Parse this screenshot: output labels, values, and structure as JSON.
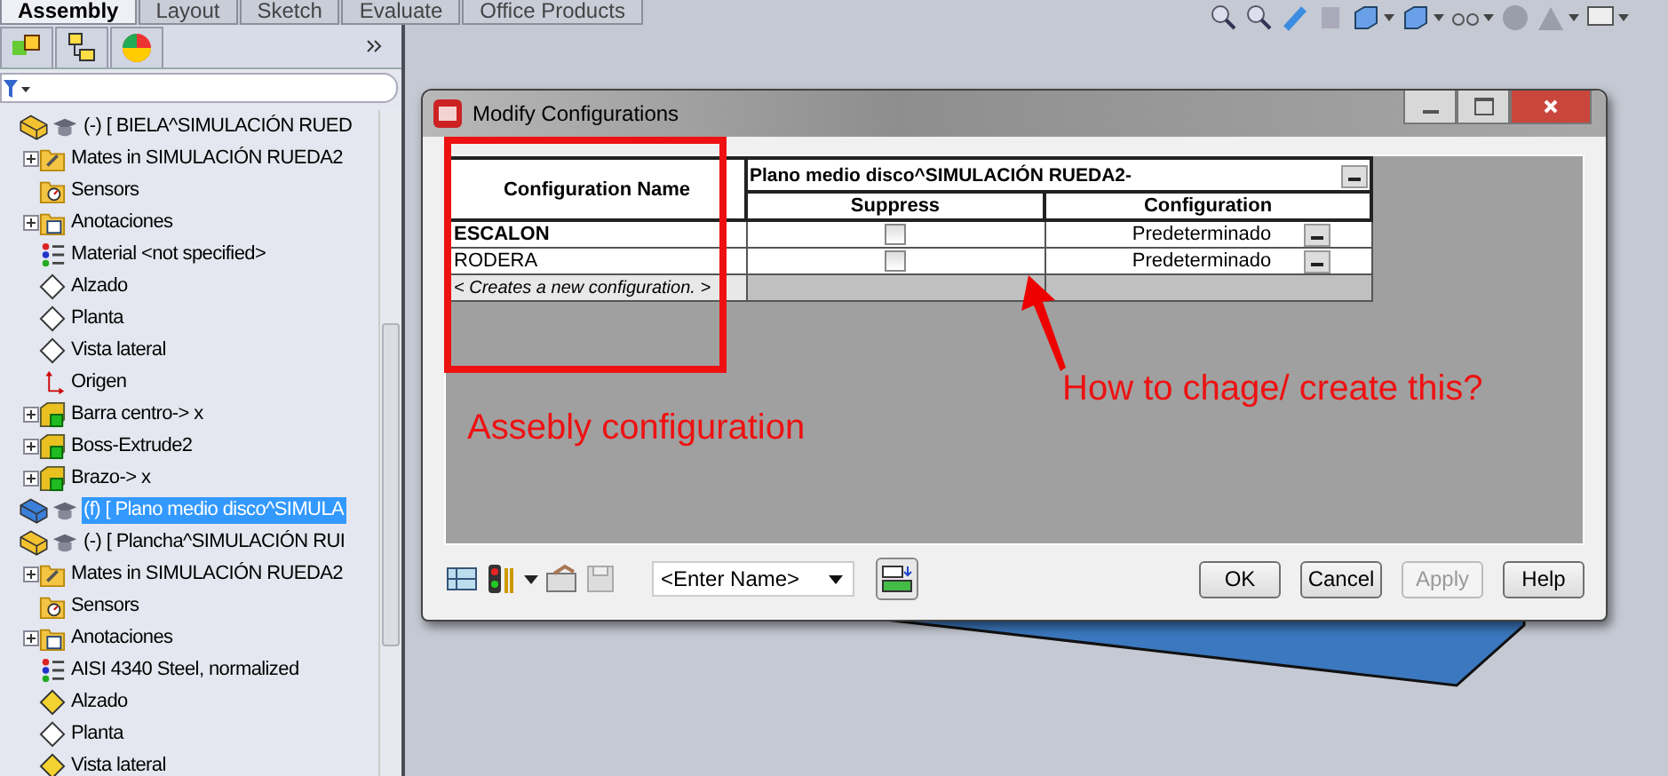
{
  "command_tabs": [
    {
      "label": "Assembly",
      "selected": true
    },
    {
      "label": "Layout",
      "selected": false
    },
    {
      "label": "Sketch",
      "selected": false
    },
    {
      "label": "Evaluate",
      "selected": false
    },
    {
      "label": "Office Products",
      "selected": false
    }
  ],
  "feature_tree": {
    "items": [
      {
        "label": "(-) [ BIELA^SIMULACIÓN RUED",
        "kind": "part",
        "expandable": false,
        "selected": false,
        "children": [
          {
            "label": "Mates in SIMULACIÓN RUEDA2",
            "kind": "mates",
            "expandable": true,
            "selected": false
          },
          {
            "label": "Sensors",
            "kind": "sensors",
            "expandable": false,
            "selected": false
          },
          {
            "label": "Anotaciones",
            "kind": "annotations",
            "expandable": true,
            "selected": false
          },
          {
            "label": "Material <not specified>",
            "kind": "material",
            "expandable": false,
            "selected": false
          },
          {
            "label": "Alzado",
            "kind": "plane",
            "expandable": false,
            "selected": false
          },
          {
            "label": "Planta",
            "kind": "plane",
            "expandable": false,
            "selected": false
          },
          {
            "label": "Vista lateral",
            "kind": "plane",
            "expandable": false,
            "selected": false
          },
          {
            "label": "Origen",
            "kind": "origin",
            "expandable": false,
            "selected": false
          },
          {
            "label": "Barra centro-> x",
            "kind": "feature",
            "expandable": true,
            "selected": false
          },
          {
            "label": "Boss-Extrude2",
            "kind": "feature",
            "expandable": true,
            "selected": false
          },
          {
            "label": "Brazo-> x",
            "kind": "feature",
            "expandable": true,
            "selected": false
          }
        ]
      },
      {
        "label": "(f) [ Plano medio disco^SIMULA",
        "kind": "part-blue",
        "expandable": false,
        "selected": true
      },
      {
        "label": "(-) [ Plancha^SIMULACIÓN RUI",
        "kind": "part",
        "expandable": false,
        "selected": false,
        "children": [
          {
            "label": "Mates in SIMULACIÓN RUEDA2",
            "kind": "mates",
            "expandable": true,
            "selected": false
          },
          {
            "label": "Sensors",
            "kind": "sensors",
            "expandable": false,
            "selected": false
          },
          {
            "label": "Anotaciones",
            "kind": "annotations",
            "expandable": true,
            "selected": false
          },
          {
            "label": "AISI 4340 Steel, normalized",
            "kind": "material",
            "expandable": false,
            "selected": false
          },
          {
            "label": "Alzado",
            "kind": "plane-yellow",
            "expandable": false,
            "selected": false
          },
          {
            "label": "Planta",
            "kind": "plane",
            "expandable": false,
            "selected": false
          },
          {
            "label": "Vista lateral",
            "kind": "plane-yellow",
            "expandable": false,
            "selected": false
          }
        ]
      }
    ]
  },
  "dialog": {
    "title": "Modify Configurations",
    "table": {
      "name_header": "Configuration Name",
      "group_header": "Plano medio disco^SIMULACIÓN RUEDA2-",
      "columns": [
        "Suppress",
        "Configuration"
      ],
      "rows": [
        {
          "name": "ESCALON",
          "active": true,
          "suppressed": false,
          "configuration": "Predeterminado"
        },
        {
          "name": "RODERA",
          "active": false,
          "suppressed": false,
          "configuration": "Predeterminado"
        }
      ],
      "new_row": "< Creates a new configuration. >"
    },
    "name_field": {
      "placeholder": "<Enter Name>"
    },
    "buttons": [
      {
        "label": "OK",
        "disabled": false
      },
      {
        "label": "Cancel",
        "disabled": false
      },
      {
        "label": "Apply",
        "disabled": true
      },
      {
        "label": "Help",
        "disabled": false
      }
    ]
  },
  "annotations": {
    "box_label": "Assebly configuration",
    "arrow_label": "How to chage/ create this?"
  }
}
